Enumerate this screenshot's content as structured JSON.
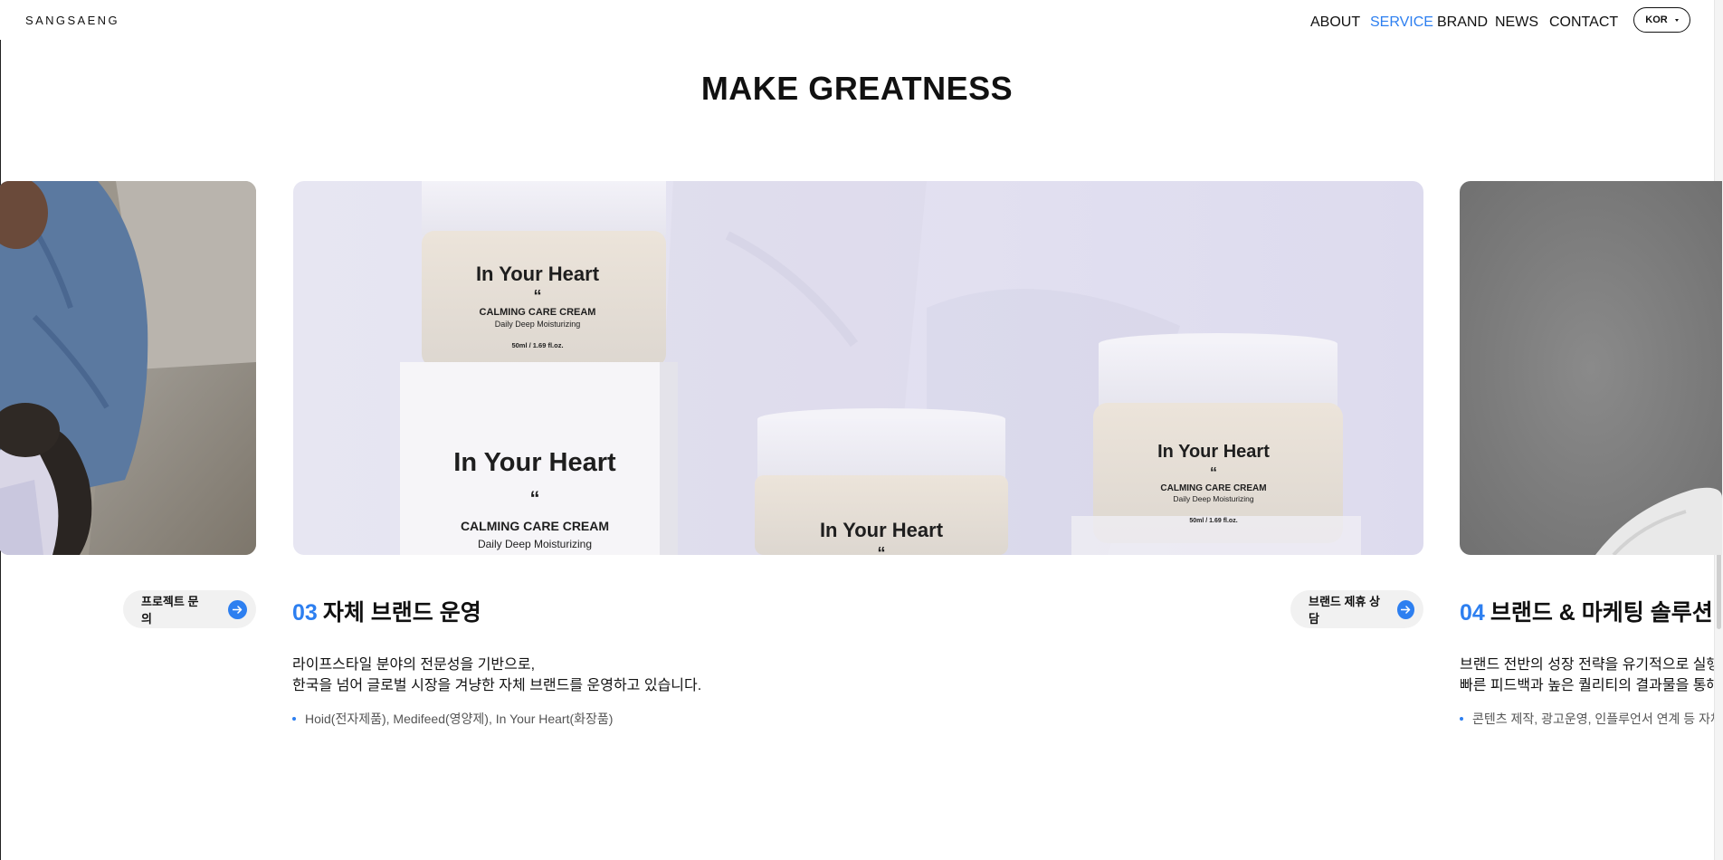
{
  "header": {
    "logo": "SANGSAENG",
    "nav": [
      "ABOUT",
      "SERVICE",
      "BRAND",
      "NEWS",
      "CONTACT"
    ],
    "active_nav": "SERVICE",
    "language": "KOR"
  },
  "main": {
    "title": "MAKE GREATNESS",
    "left_card": {
      "button_label": "프로젝트 문의"
    },
    "center_card": {
      "number": "03",
      "title": "자체 브랜드 운영",
      "button_label": "브랜드 제휴 상담",
      "description": [
        "라이프스타일 분야의 전문성을 기반으로,",
        "한국을 넘어 글로벌 시장을 겨냥한 자체 브랜드를 운영하고 있습니다."
      ],
      "bullet": "Hoid(전자제품), Medifeed(영양제), In Your Heart(화장품)",
      "product_labels": {
        "brand": "In Your Heart",
        "quote": "“",
        "product": "CALMING CARE CREAM",
        "subtitle": "Daily Deep Moisturizing",
        "volume": "50ml / 1.69 fl.oz."
      }
    },
    "right_card": {
      "number": "04",
      "title": "브랜드 & 마케팅 솔루션",
      "description": [
        "브랜드 전반의 성장 전략을 유기적으로 실행하",
        "빠른 피드백과 높은 퀄리티의 결과물을 통해 마"
      ],
      "bullet": "콘텐츠 제작, 광고운영, 인플루언서 연계 등 자체"
    }
  },
  "colors": {
    "accent": "#2d7ff0",
    "text": "#111111",
    "pill_bg": "#f1f1f1",
    "center_image_bg": "#e4e2f3"
  },
  "icons": {
    "lang_caret": "caret-down-icon",
    "pill_arrow": "arrow-right-icon"
  }
}
